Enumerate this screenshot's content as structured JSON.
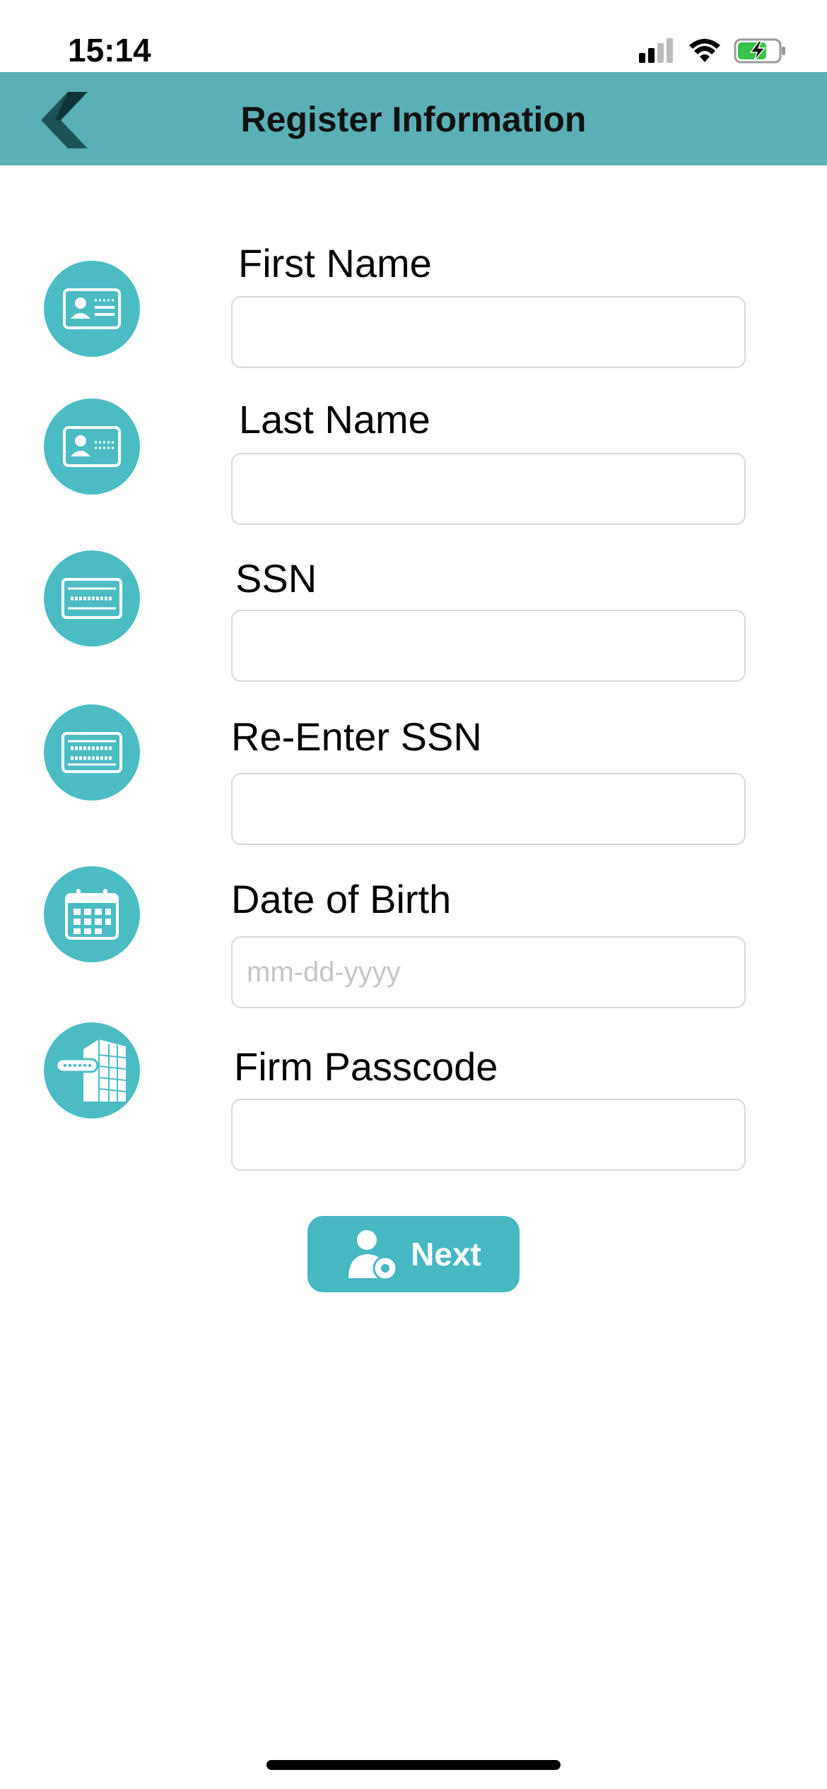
{
  "status_bar": {
    "time": "15:14"
  },
  "header": {
    "title": "Register Information",
    "back_icon": "chevron-left-icon"
  },
  "form": {
    "fields": [
      {
        "label": "First Name",
        "value": "",
        "placeholder": "",
        "icon": "id-card-icon"
      },
      {
        "label": "Last Name",
        "value": "",
        "placeholder": "",
        "icon": "id-card-icon"
      },
      {
        "label": "SSN",
        "value": "",
        "placeholder": "",
        "icon": "ssn-card-icon"
      },
      {
        "label": "Re-Enter SSN",
        "value": "",
        "placeholder": "",
        "icon": "ssn-card-double-icon"
      },
      {
        "label": "Date of Birth",
        "value": "",
        "placeholder": "mm-dd-yyyy",
        "icon": "calendar-icon"
      },
      {
        "label": "Firm Passcode",
        "value": "",
        "placeholder": "",
        "icon": "building-passcode-icon"
      }
    ]
  },
  "actions": {
    "next_label": "Next",
    "next_icon": "user-settings-icon"
  },
  "colors": {
    "accent": "#45b8c2",
    "header_bg": "#5bb0b8",
    "icon_circle": "#4bbcc4"
  }
}
